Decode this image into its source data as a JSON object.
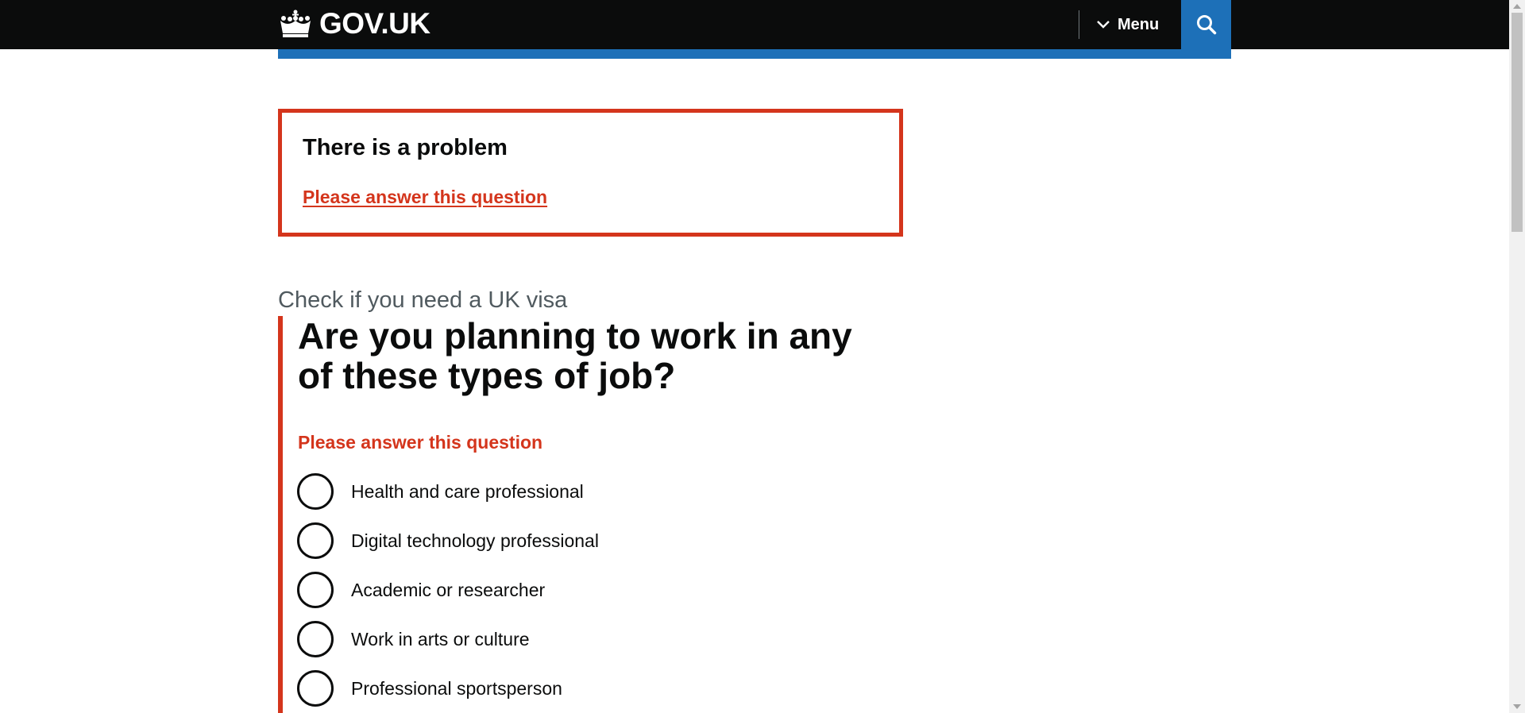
{
  "header": {
    "logo_text": "GOV.UK",
    "menu_label": "Menu",
    "search_label": "Search GOV.UK",
    "colors": {
      "background": "#0b0c0c",
      "accent": "#1d70b8"
    }
  },
  "error_summary": {
    "title": "There is a problem",
    "link": "Please answer this question",
    "border_color": "#d4351c"
  },
  "question": {
    "caption": "Check if you need a UK visa",
    "title": "Are you planning to work in any of these types of job?",
    "error_message": "Please answer this question",
    "options": [
      {
        "label": "Health and care professional",
        "selected": false
      },
      {
        "label": "Digital technology professional",
        "selected": false
      },
      {
        "label": "Academic or researcher",
        "selected": false
      },
      {
        "label": "Work in arts or culture",
        "selected": false
      },
      {
        "label": "Professional sportsperson",
        "selected": false
      }
    ]
  },
  "icons": [
    "crown-icon",
    "chevron-down-icon",
    "search-icon"
  ]
}
